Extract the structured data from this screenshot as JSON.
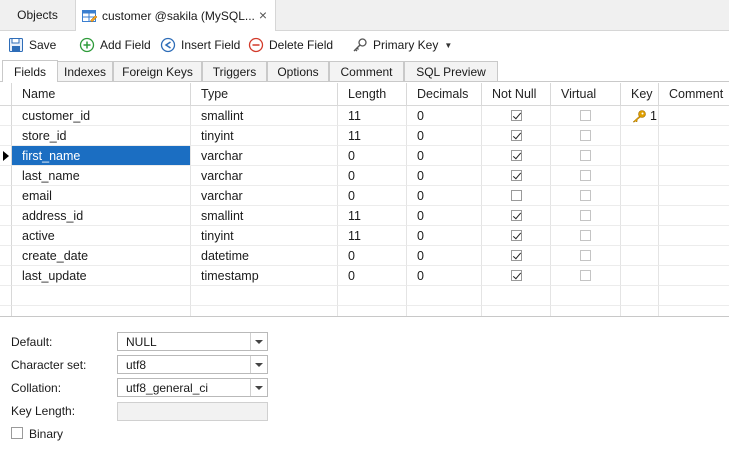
{
  "window_tabs": {
    "objects": "Objects",
    "table": "customer @sakila (MySQL...",
    "close": "×"
  },
  "toolbar": {
    "save": "Save",
    "add_field": "Add Field",
    "insert_field": "Insert Field",
    "delete_field": "Delete Field",
    "primary_key": "Primary Key",
    "caret": "▼"
  },
  "sub_tabs": [
    "Fields",
    "Indexes",
    "Foreign Keys",
    "Triggers",
    "Options",
    "Comment",
    "SQL Preview"
  ],
  "grid": {
    "columns": [
      "Name",
      "Type",
      "Length",
      "Decimals",
      "Not Null",
      "Virtual",
      "Key",
      "Comment"
    ],
    "rows": [
      {
        "name": "customer_id",
        "type": "smallint",
        "length": "11",
        "decimals": "0",
        "not_null": true,
        "virtual": false,
        "key": "1"
      },
      {
        "name": "store_id",
        "type": "tinyint",
        "length": "11",
        "decimals": "0",
        "not_null": true,
        "virtual": false,
        "key": ""
      },
      {
        "name": "first_name",
        "type": "varchar",
        "length": "0",
        "decimals": "0",
        "not_null": true,
        "virtual": false,
        "key": ""
      },
      {
        "name": "last_name",
        "type": "varchar",
        "length": "0",
        "decimals": "0",
        "not_null": true,
        "virtual": false,
        "key": ""
      },
      {
        "name": "email",
        "type": "varchar",
        "length": "0",
        "decimals": "0",
        "not_null": false,
        "virtual": false,
        "key": ""
      },
      {
        "name": "address_id",
        "type": "smallint",
        "length": "11",
        "decimals": "0",
        "not_null": true,
        "virtual": false,
        "key": ""
      },
      {
        "name": "active",
        "type": "tinyint",
        "length": "11",
        "decimals": "0",
        "not_null": true,
        "virtual": false,
        "key": ""
      },
      {
        "name": "create_date",
        "type": "datetime",
        "length": "0",
        "decimals": "0",
        "not_null": true,
        "virtual": false,
        "key": ""
      },
      {
        "name": "last_update",
        "type": "timestamp",
        "length": "0",
        "decimals": "0",
        "not_null": true,
        "virtual": false,
        "key": ""
      }
    ],
    "selected_row": 2
  },
  "properties": {
    "default_label": "Default:",
    "default_value": "NULL",
    "charset_label": "Character set:",
    "charset_value": "utf8",
    "collation_label": "Collation:",
    "collation_value": "utf8_general_ci",
    "key_length_label": "Key Length:",
    "binary_label": "Binary"
  },
  "colors": {
    "selection": "#1b6ec2",
    "key_icon": "#e0a000"
  }
}
